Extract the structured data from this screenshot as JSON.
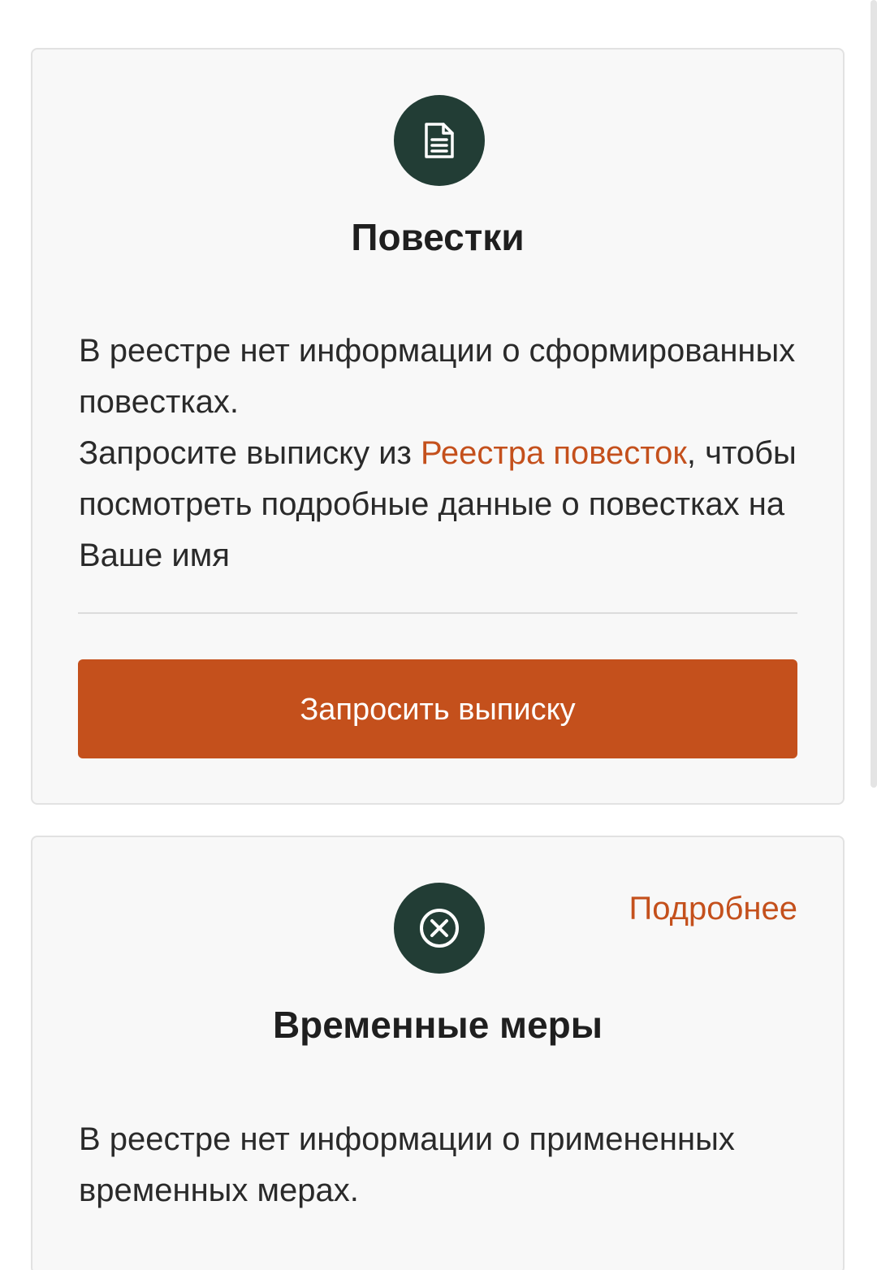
{
  "summons_card": {
    "icon": "document-icon",
    "title": "Повестки",
    "text_line_1": "В реестре нет информации о сформированных повестках.",
    "text_before_link": "Запросите выписку из ",
    "link_label": "Реестра повесток",
    "text_after_link": ", чтобы посмотреть подробные данные о повестках на Ваше имя",
    "button_label": "Запросить выписку"
  },
  "temporary_measures_card": {
    "icon": "close-circle-icon",
    "more_label": "Подробнее",
    "title": "Временные меры",
    "text": "В реестре нет информации о примененных временных мерах."
  },
  "colors": {
    "accent": "#c4501c",
    "icon_background": "#223d35",
    "card_background": "#f8f8f8"
  }
}
